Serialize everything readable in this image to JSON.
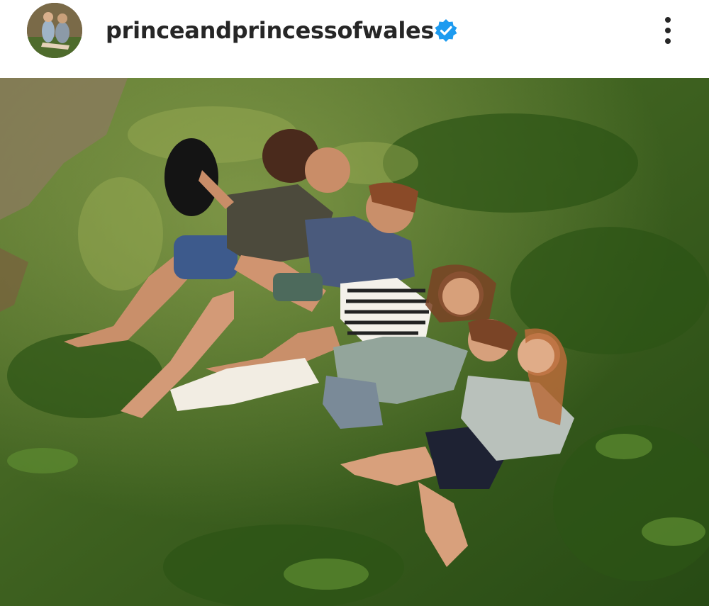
{
  "post": {
    "username": "princeandprincessofwales",
    "verified": true,
    "accent_color": "#1d9bf0",
    "icons": {
      "verified": "verified-badge-icon",
      "more": "more-options-icon"
    }
  }
}
